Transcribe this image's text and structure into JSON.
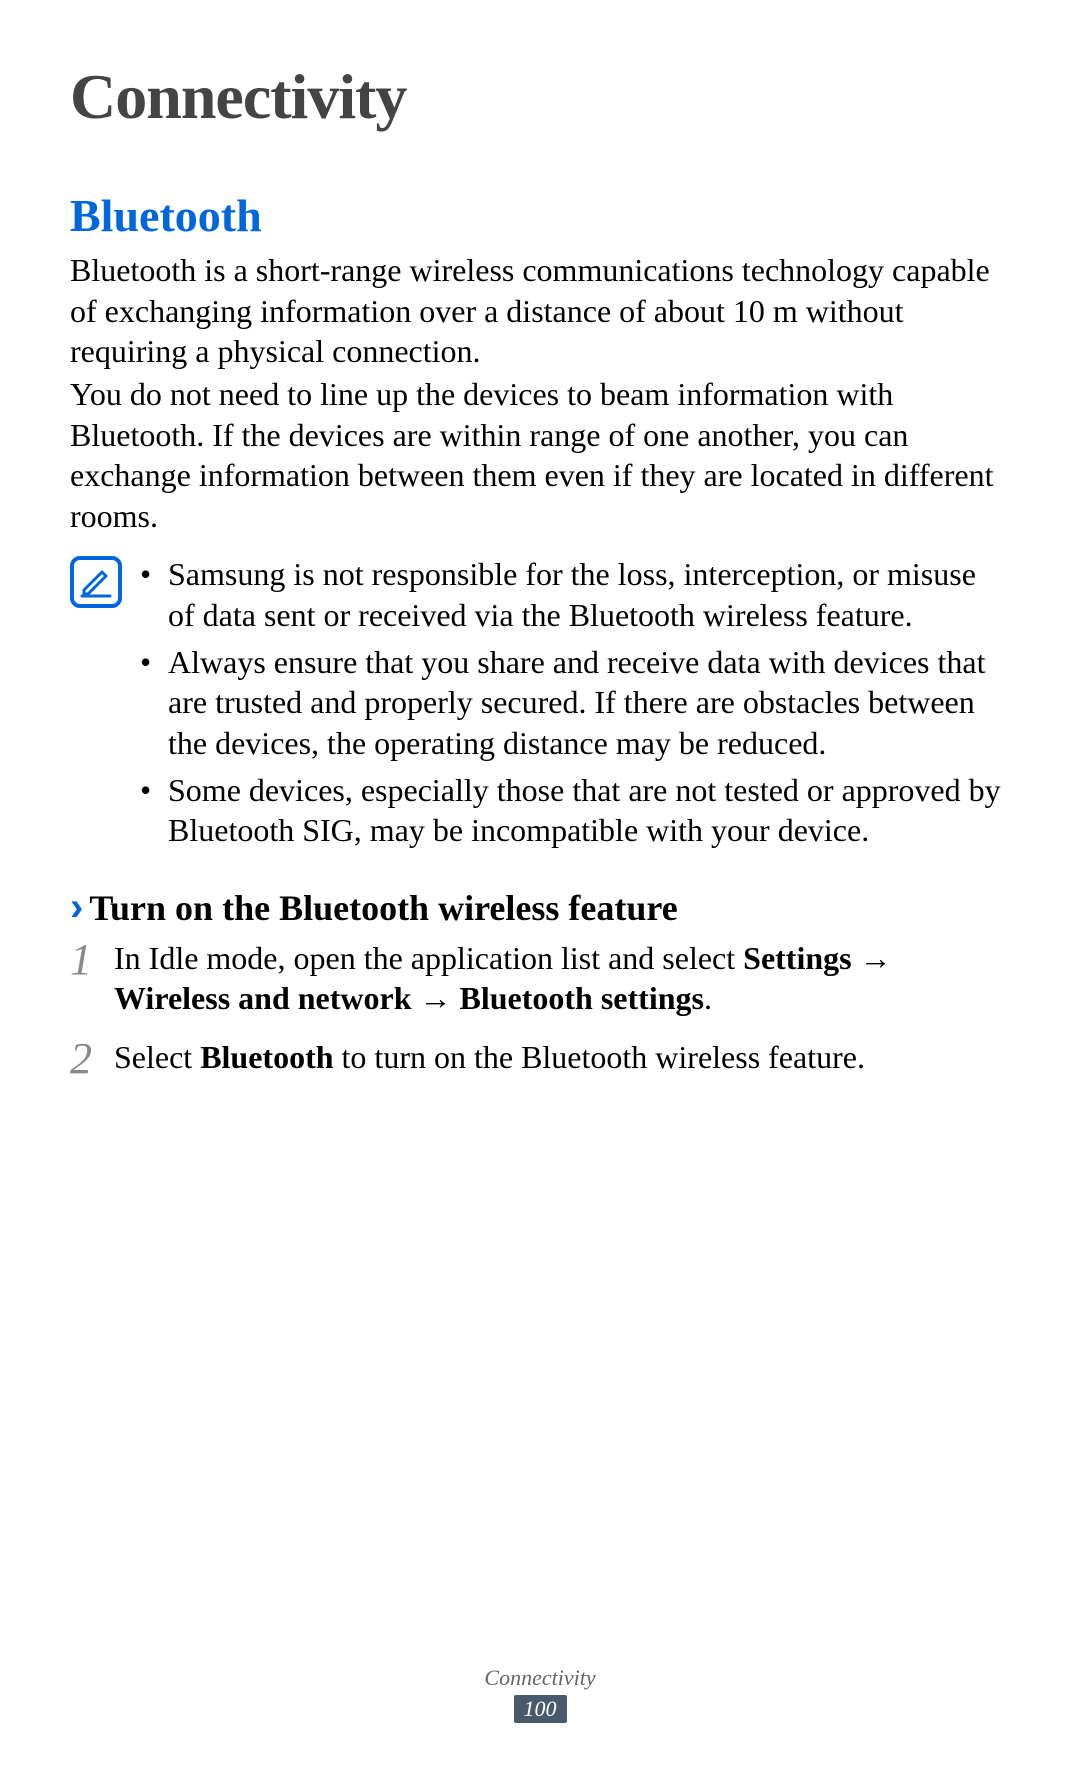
{
  "page_title": "Connectivity",
  "section_title": "Bluetooth",
  "paragraph1": "Bluetooth is a short-range wireless communications technology capable of exchanging information over a distance of about 10 m without requiring a physical connection.",
  "paragraph2": "You do not need to line up the devices to beam information with Bluetooth. If the devices are within range of one another, you can exchange information between them even if they are located in different rooms.",
  "notes": [
    "Samsung is not responsible for the loss, interception, or misuse of data sent or received via the Bluetooth wireless feature.",
    "Always ensure that you share and receive data with devices that are trusted and properly secured. If there are obstacles between the devices, the operating distance may be reduced.",
    "Some devices, especially those that are not tested or approved by Bluetooth SIG, may be incompatible with your device."
  ],
  "subsection_title": "Turn on the Bluetooth wireless feature",
  "steps": [
    {
      "num": "1",
      "pre": "In Idle mode, open the application list and select ",
      "bold1": "Settings",
      "mid1": " → ",
      "bold2": "Wireless and network",
      "mid2": " → ",
      "bold3": "Bluetooth settings",
      "post": "."
    },
    {
      "num": "2",
      "pre": "Select ",
      "bold1": "Bluetooth",
      "post": " to turn on the Bluetooth wireless feature."
    }
  ],
  "footer_section": "Connectivity",
  "footer_page": "100"
}
